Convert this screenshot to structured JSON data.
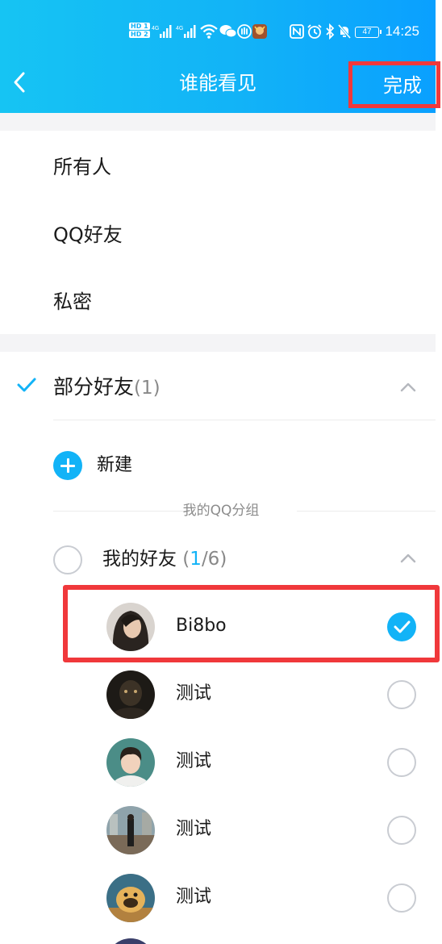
{
  "status_bar": {
    "hd1": "HD 1",
    "hd2": "HD 2",
    "sig1": "4G",
    "sig2": "4G",
    "battery": "47",
    "time": "14:25"
  },
  "header": {
    "title": "谁能看见",
    "done_label": "完成"
  },
  "options": [
    "所有人",
    "QQ好友",
    "私密"
  ],
  "partial": {
    "label": "部分好友",
    "count": "(1)",
    "new_label": "新建",
    "group_section_label": "我的QQ分组"
  },
  "group": {
    "name": "我的好友",
    "open_paren": " (",
    "selected": "1",
    "total": "/6)"
  },
  "friends": [
    {
      "name": "Bi8bo",
      "checked": true
    },
    {
      "name": "测试",
      "checked": false
    },
    {
      "name": "测试",
      "checked": false
    },
    {
      "name": "测试",
      "checked": false
    },
    {
      "name": "测试",
      "checked": false
    }
  ],
  "colors": {
    "accent": "#12b3f7",
    "highlight": "#f0383b"
  }
}
